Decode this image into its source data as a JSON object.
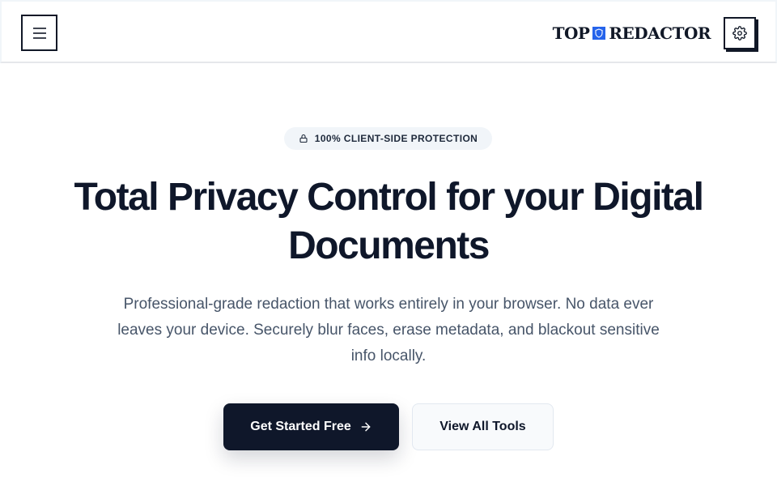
{
  "header": {
    "brand_left": "TOP",
    "brand_right": "REDACTOR",
    "menu_icon": "hamburger-icon",
    "settings_icon": "gear-icon"
  },
  "hero": {
    "badge_text": "100% CLIENT-SIDE PROTECTION",
    "badge_icon": "lock-icon",
    "title": "Total Privacy Control for your Digital Documents",
    "subtitle": "Professional-grade redaction that works entirely in your browser. No data ever leaves your device. Securely blur faces, erase metadata, and blackout sensitive info locally.",
    "primary_cta": "Get Started Free",
    "primary_cta_icon": "arrow-right-icon",
    "secondary_cta": "View All Tools"
  },
  "colors": {
    "primary": "#0f172a",
    "accent": "#2563eb",
    "muted_text": "#475569",
    "badge_bg": "#f1f5f9"
  }
}
